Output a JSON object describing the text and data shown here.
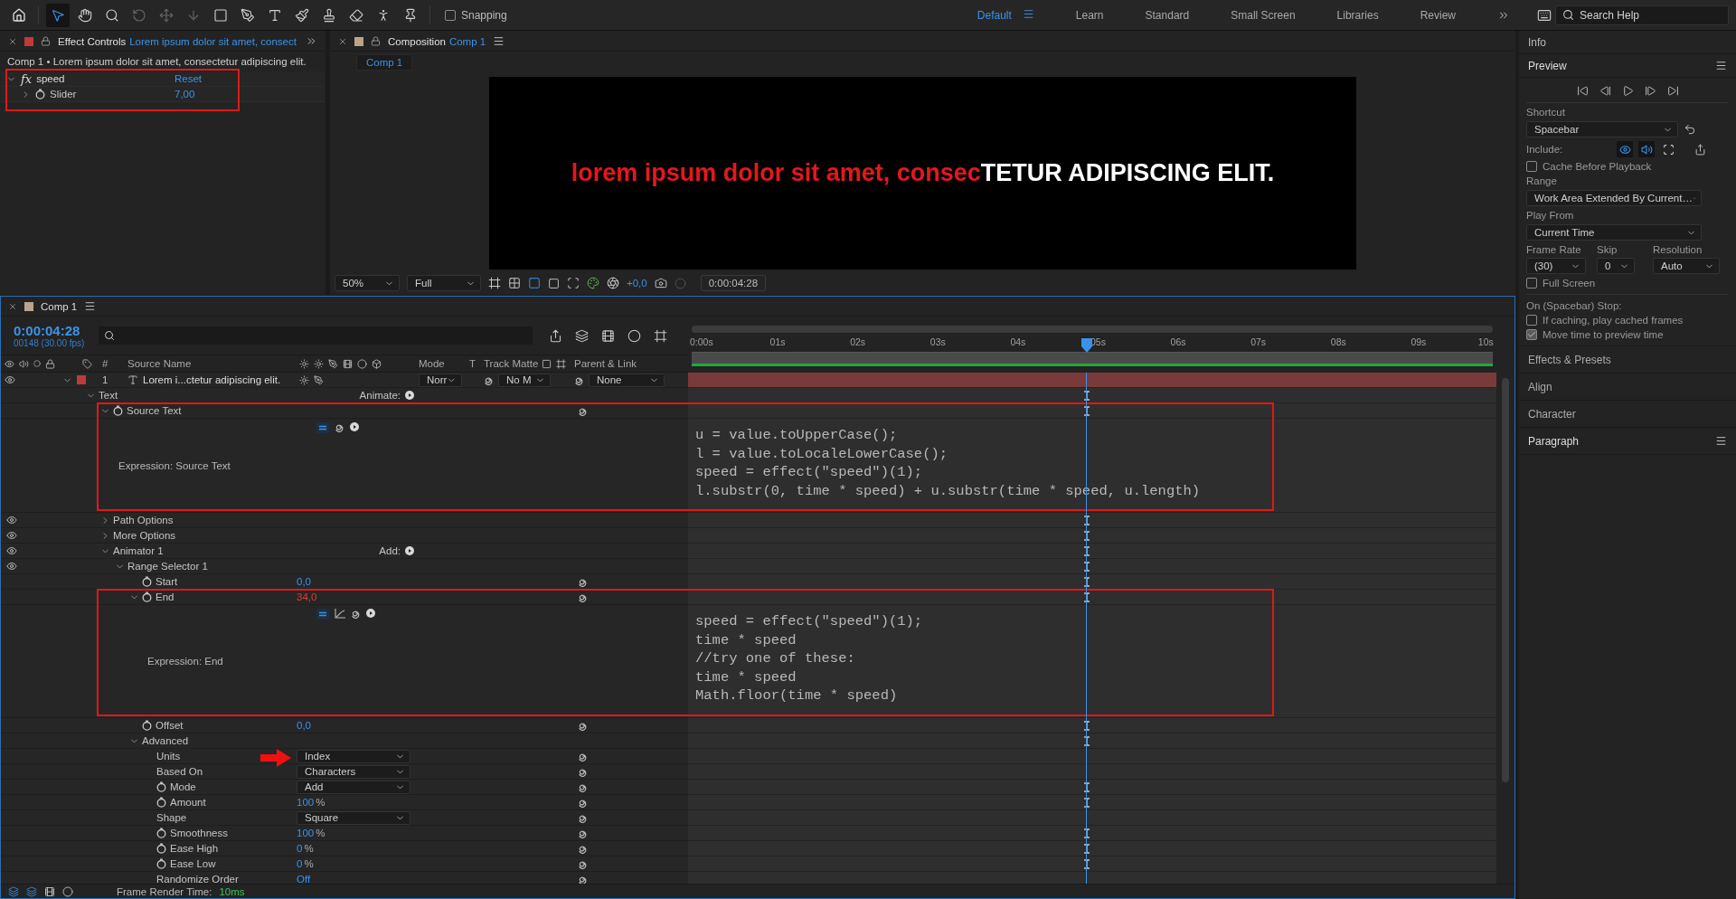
{
  "toolbar": {
    "workspaces": [
      {
        "label": "Default",
        "selected": true
      },
      {
        "label": "Learn",
        "selected": false
      },
      {
        "label": "Standard",
        "selected": false
      },
      {
        "label": "Small Screen",
        "selected": false
      },
      {
        "label": "Libraries",
        "selected": false
      },
      {
        "label": "Review",
        "selected": false
      }
    ],
    "snapping": {
      "label": "Snapping",
      "checked": false
    },
    "search": {
      "placeholder": "Search Help"
    }
  },
  "effect_controls": {
    "title": "Effect Controls",
    "subject": "Lorem ipsum dolor sit amet, consect",
    "breadcrumb": "Comp 1 • Lorem ipsum dolor sit amet, consectetur adipiscing elit.",
    "effect": {
      "fx": "fx",
      "name": "speed",
      "reset": "Reset",
      "expanded": true,
      "highlighted": true,
      "property": {
        "name": "Slider",
        "value": "7,00",
        "expanded": false
      }
    }
  },
  "composition": {
    "title": "Composition",
    "subject": "Comp 1",
    "view_tab": "Comp 1",
    "text_lower": "lorem ipsum dolor sit amet, consec",
    "text_upper": "TETUR ADIPISCING ELIT.",
    "magnification": "50%",
    "resolution": "Full",
    "exposure": "+0,0",
    "timecode": "0:00:04:28"
  },
  "timeline": {
    "title": "Comp 1",
    "timecode": "0:00:04:28",
    "frame_info": "00148 (30.00 fps)",
    "columns": {
      "number": "#",
      "source_name": "Source Name",
      "mode": "Mode",
      "preserve": "T",
      "track_matte": "Track Matte",
      "parent": "Parent & Link"
    },
    "ruler": [
      "0:00s",
      "01s",
      "02s",
      "03s",
      "04s",
      "05s",
      "06s",
      "07s",
      "08s",
      "09s",
      "10s"
    ],
    "playhead": {
      "level": 0.4933
    },
    "layer": {
      "number": "1",
      "name": "Lorem i...ctetur adipiscing elit.",
      "mode": "Norr",
      "track_matte": "No M",
      "parent": "None",
      "expanded": true
    },
    "properties": [
      {
        "name": "Text",
        "kind": "group",
        "expanded": true,
        "eye": false,
        "action": "Animate:",
        "marker": true,
        "children": [
          {
            "name": "Source Text",
            "kind": "property",
            "stopwatch": true,
            "expanded": true,
            "highlighted": true,
            "marker": true,
            "children": [
              {
                "kind": "expression",
                "name": "Expression: Source Text",
                "graph": false,
                "code": [
                  "u = value.toUpperCase();",
                  "l = value.toLocaleLowerCase();",
                  "speed = effect(\"speed\")(1);",
                  "l.substr(0, time * speed) + u.substr(time * speed, u.length)"
                ]
              }
            ]
          },
          {
            "name": "Path Options",
            "kind": "group",
            "expanded": false,
            "eye": true,
            "marker": true
          },
          {
            "name": "More Options",
            "kind": "group",
            "expanded": false,
            "eye": true,
            "marker": true
          },
          {
            "name": "Animator 1",
            "kind": "group",
            "expanded": true,
            "eye": true,
            "action": "Add:",
            "marker": true,
            "children": [
              {
                "name": "Range Selector 1",
                "kind": "group",
                "expanded": true,
                "eye": true,
                "marker": true,
                "children": [
                  {
                    "name": "Start",
                    "kind": "property",
                    "stopwatch": true,
                    "value": "0,0",
                    "driven": false,
                    "highlighted": false,
                    "marker": true
                  },
                  {
                    "name": "End",
                    "kind": "property",
                    "stopwatch": true,
                    "expanded": true,
                    "value": "34,0",
                    "driven": true,
                    "highlighted": true,
                    "marker": true,
                    "children": [
                      {
                        "kind": "expression",
                        "name": "Expression: End",
                        "graph": true,
                        "code": [
                          "speed = effect(\"speed\")(1);",
                          "time * speed",
                          "//try one of these:",
                          "time * speed",
                          "Math.floor(time * speed)"
                        ]
                      }
                    ]
                  },
                  {
                    "name": "Offset",
                    "kind": "property",
                    "stopwatch": true,
                    "value": "0,0",
                    "driven": false,
                    "highlighted": false,
                    "marker": true
                  },
                  {
                    "name": "Advanced",
                    "kind": "group",
                    "expanded": true,
                    "eye": false,
                    "marker": true,
                    "children": [
                      {
                        "name": "Units",
                        "kind": "dropdown",
                        "stopwatch": false,
                        "value": "Index",
                        "annotated": true,
                        "marker": false
                      },
                      {
                        "name": "Based On",
                        "kind": "dropdown",
                        "stopwatch": false,
                        "value": "Characters",
                        "annotated": false,
                        "marker": false
                      },
                      {
                        "name": "Mode",
                        "kind": "dropdown",
                        "stopwatch": true,
                        "value": "Add",
                        "annotated": false,
                        "marker": true
                      },
                      {
                        "name": "Amount",
                        "kind": "property",
                        "stopwatch": true,
                        "value": "100",
                        "unit": "%",
                        "driven": false,
                        "marker": true
                      },
                      {
                        "name": "Shape",
                        "kind": "dropdown",
                        "stopwatch": false,
                        "value": "Square",
                        "annotated": false,
                        "marker": false
                      },
                      {
                        "name": "Smoothness",
                        "kind": "property",
                        "stopwatch": true,
                        "value": "100",
                        "unit": "%",
                        "driven": false,
                        "marker": true
                      },
                      {
                        "name": "Ease High",
                        "kind": "property",
                        "stopwatch": true,
                        "value": "0",
                        "unit": "%",
                        "driven": false,
                        "marker": true
                      },
                      {
                        "name": "Ease Low",
                        "kind": "property",
                        "stopwatch": true,
                        "value": "0",
                        "unit": "%",
                        "driven": false,
                        "marker": true
                      },
                      {
                        "name": "Randomize Order",
                        "kind": "property",
                        "stopwatch": false,
                        "value": "Off",
                        "driven": false,
                        "marker": false
                      }
                    ]
                  }
                ]
              }
            ]
          }
        ]
      }
    ]
  },
  "right_panel": {
    "info": "Info",
    "preview": {
      "title": "Preview",
      "shortcut_label": "Shortcut",
      "shortcut": "Spacebar",
      "include_label": "Include:",
      "include": [
        {
          "kind": "video",
          "on": true
        },
        {
          "kind": "audio",
          "on": true
        },
        {
          "kind": "overlays",
          "on": false
        }
      ],
      "cache": {
        "label": "Cache Before Playback",
        "checked": false
      },
      "range_label": "Range",
      "range": "Work Area Extended By Current…",
      "play_from_label": "Play From",
      "play_from": "Current Time",
      "frame_rate_label": "Frame Rate",
      "frame_rate": "(30)",
      "skip_label": "Skip",
      "skip": "0",
      "resolution_label": "Resolution",
      "resolution": "Auto",
      "full_screen": {
        "label": "Full Screen",
        "checked": false
      },
      "stop_label": "On (Spacebar) Stop:",
      "stop_options": [
        {
          "label": "If caching, play cached frames",
          "checked": false
        },
        {
          "label": "Move time to preview time",
          "checked": true
        }
      ]
    },
    "panels": [
      {
        "label": "Effects & Presets",
        "menu": false
      },
      {
        "label": "Align",
        "menu": false
      },
      {
        "label": "Character",
        "menu": false
      },
      {
        "label": "Paragraph",
        "menu": true
      }
    ]
  },
  "status_bar": {
    "label": "Frame Render Time:",
    "value": "10ms"
  }
}
